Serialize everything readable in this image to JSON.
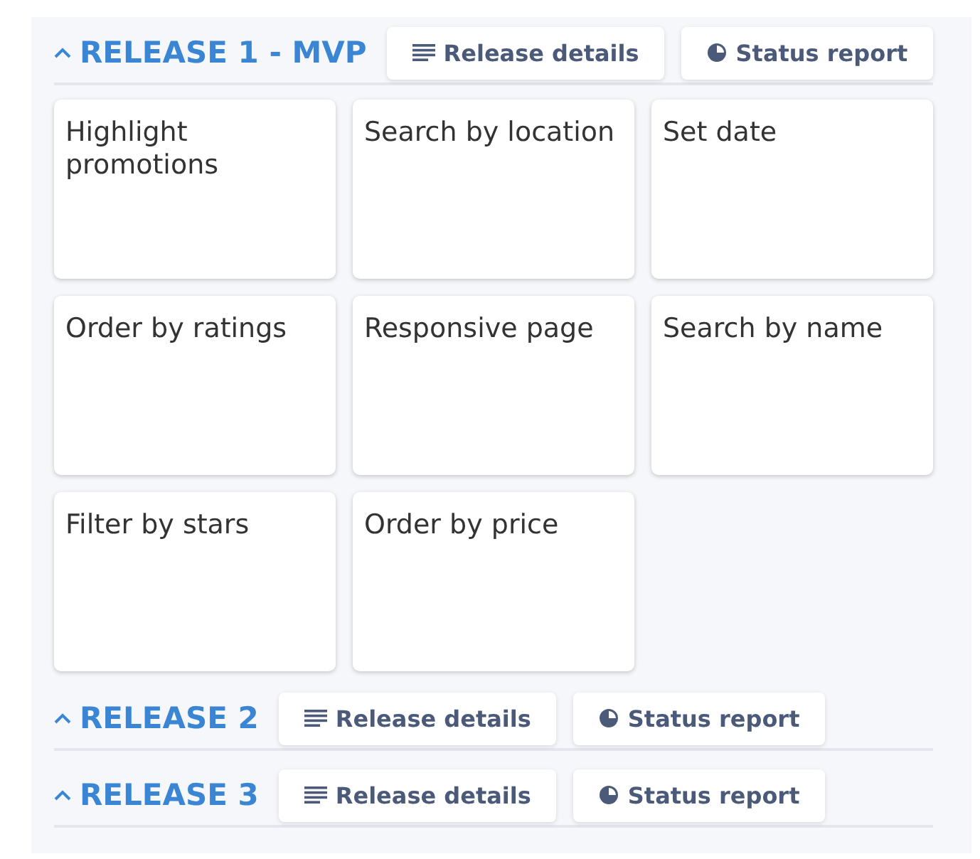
{
  "releases": [
    {
      "title": "RELEASE 1 - MVP",
      "buttons": [
        {
          "kind": "details",
          "label": "Release details"
        },
        {
          "kind": "status",
          "label": "Status report"
        }
      ],
      "cards": [
        "Highlight promotions",
        "Search by location",
        "Set date",
        "Order by ratings",
        "Responsive page",
        "Search by name",
        "Filter by stars",
        "Order by price"
      ]
    },
    {
      "title": "RELEASE 2",
      "buttons": [
        {
          "kind": "details",
          "label": "Release details"
        },
        {
          "kind": "status",
          "label": "Status report"
        }
      ]
    },
    {
      "title": "RELEASE 3",
      "buttons": [
        {
          "kind": "details",
          "label": "Release details"
        },
        {
          "kind": "status",
          "label": "Status report"
        }
      ]
    }
  ]
}
